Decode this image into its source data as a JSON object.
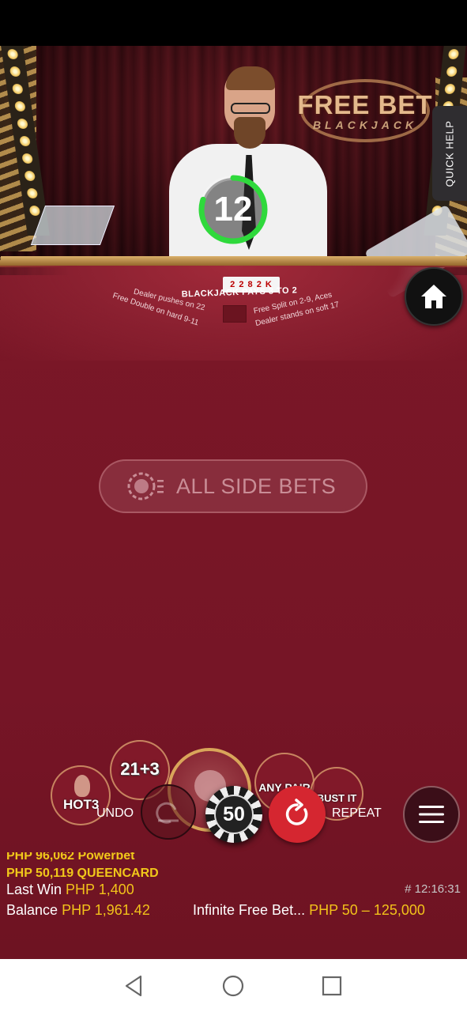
{
  "header": {
    "quick_help_label": "QUICK HELP"
  },
  "game": {
    "logo_line1": "FREE BET",
    "logo_line2": "BLACKJACK",
    "timer_value": "12",
    "timer_progress": 0.8,
    "table_text": {
      "cards": "2 2 8 2 K",
      "pays": "BLACKJACK PAYS 3 TO 2",
      "rule_push": "Dealer pushes on 22",
      "rule_double": "Free Double on hard 9-11",
      "rule_split": "Free Split on 2-9, Aces",
      "rule_stands": "Dealer stands on soft 17"
    }
  },
  "side_bets": {
    "label": "ALL SIDE BETS"
  },
  "betting": {
    "hot3_label": "HOT3",
    "p213_label": "21+3",
    "any_pair_label": "ANY PAIR",
    "bust_it_label": "BUST IT",
    "undo_label": "UNDO",
    "chip_value": "50",
    "repeat_label": "REPEAT"
  },
  "ticker": {
    "line1": "PHP 96,062 Powerbet",
    "line2": "PHP 50,119 QUEENCARD"
  },
  "info": {
    "last_win_label": "Last Win",
    "last_win_value": "PHP 1,400",
    "balance_label": "Balance",
    "balance_value": "PHP 1,961.42",
    "table_name": "Infinite Free Bet...",
    "limits": "PHP 50 – 125,000",
    "round_time": "# 12:16:31"
  },
  "colors": {
    "felt": "#7a1727",
    "gold_text": "#f2c21a",
    "timer_ring": "#2fd93c",
    "repeat_red": "#d52630"
  },
  "icons": [
    "home-icon",
    "menu-icon",
    "undo-icon",
    "repeat-icon",
    "side-bets-icon",
    "nav-back-icon",
    "nav-home-icon",
    "nav-recents-icon"
  ]
}
